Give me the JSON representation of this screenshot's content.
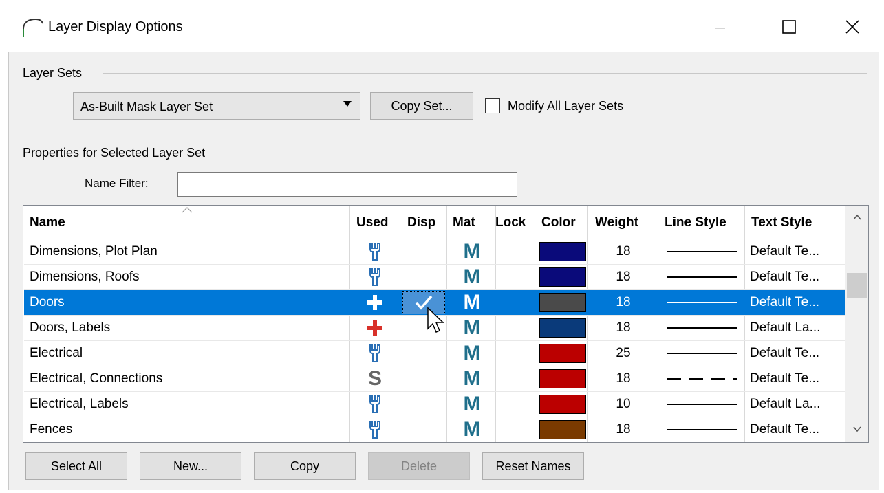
{
  "window": {
    "title": "Layer Display Options",
    "app_icon": "arch-icon",
    "controls": [
      "minimize-icon",
      "maximize-icon",
      "close-icon"
    ]
  },
  "layer_sets": {
    "group_label": "Layer Sets",
    "selected_set": "As-Built Mask Layer Set",
    "copy_set_label": "Copy Set...",
    "modify_all_label": "Modify All Layer Sets",
    "modify_all_checked": false
  },
  "properties": {
    "group_label": "Properties for Selected Layer Set",
    "name_filter_label": "Name Filter:",
    "name_filter_value": ""
  },
  "table": {
    "columns": [
      "Name",
      "Used",
      "Disp",
      "Mat",
      "Lock",
      "Color",
      "Weight",
      "Line Style",
      "Text Style"
    ],
    "rows": [
      {
        "name": "Dimensions, Plot Plan",
        "used": "wrench",
        "disp": false,
        "mat": "M",
        "lock": false,
        "color": "#0a0a7a",
        "weight": "18",
        "line_style": "solid",
        "text_style": "Default Te..."
      },
      {
        "name": "Dimensions, Roofs",
        "used": "wrench",
        "disp": false,
        "mat": "M",
        "lock": false,
        "color": "#0a0a7a",
        "weight": "18",
        "line_style": "solid",
        "text_style": "Default Te..."
      },
      {
        "name": "Doors",
        "used": "plus",
        "disp": true,
        "mat": "M",
        "lock": false,
        "color": "#4a4a4a",
        "weight": "18",
        "line_style": "solid",
        "text_style": "Default Te...",
        "selected": true
      },
      {
        "name": "Doors, Labels",
        "used": "plus",
        "disp": false,
        "mat": "M",
        "lock": false,
        "color": "#0a3a7a",
        "weight": "18",
        "line_style": "solid",
        "text_style": "Default La..."
      },
      {
        "name": "Electrical",
        "used": "wrench",
        "disp": false,
        "mat": "M",
        "lock": false,
        "color": "#bb0000",
        "weight": "25",
        "line_style": "solid",
        "text_style": "Default Te..."
      },
      {
        "name": "Electrical, Connections",
        "used": "S",
        "disp": false,
        "mat": "M",
        "lock": false,
        "color": "#bb0000",
        "weight": "18",
        "line_style": "dashed",
        "text_style": "Default Te..."
      },
      {
        "name": "Electrical, Labels",
        "used": "wrench",
        "disp": false,
        "mat": "M",
        "lock": false,
        "color": "#bb0000",
        "weight": "10",
        "line_style": "solid",
        "text_style": "Default La..."
      },
      {
        "name": "Fences",
        "used": "wrench",
        "disp": false,
        "mat": "M",
        "lock": false,
        "color": "#7a3a00",
        "weight": "18",
        "line_style": "solid",
        "text_style": "Default Te..."
      }
    ]
  },
  "buttons": {
    "select_all": "Select All",
    "new": "New...",
    "copy": "Copy",
    "delete": "Delete",
    "reset_names": "Reset Names"
  },
  "colors": {
    "selection": "#0078d7",
    "mat_icon": "#1f6f8b",
    "used_plus": "#d8312a",
    "used_wrench": "#2a6fb5"
  }
}
